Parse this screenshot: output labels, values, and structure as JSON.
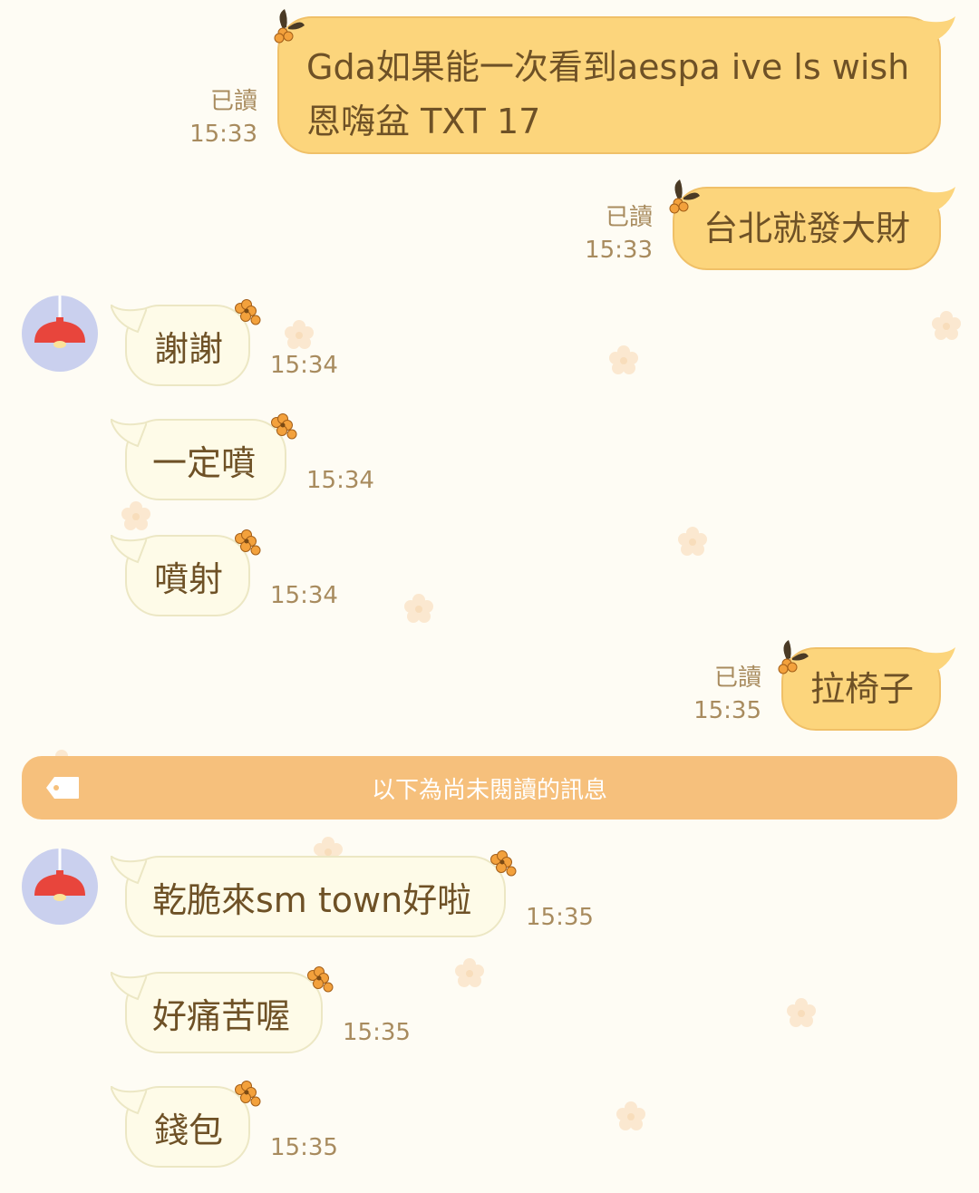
{
  "chat": {
    "outgoing": [
      {
        "line1": "Gda如果能一次看到aespa ive ls wish",
        "line2": "恩嗨盆 TXT 17",
        "read": "已讀",
        "time": "15:33"
      },
      {
        "text": "台北就發大財",
        "read": "已讀",
        "time": "15:33"
      },
      {
        "text": "拉椅子",
        "read": "已讀",
        "time": "15:35"
      }
    ],
    "incoming": [
      {
        "text": "謝謝",
        "time": "15:34"
      },
      {
        "text": "一定噴",
        "time": "15:34"
      },
      {
        "text": "噴射",
        "time": "15:34"
      },
      {
        "text": "乾脆來sm town好啦",
        "time": "15:35"
      },
      {
        "text": "好痛苦喔",
        "time": "15:35"
      },
      {
        "text": "錢包",
        "time": "15:35"
      }
    ],
    "unread_divider": "以下為尚未閱讀的訊息"
  },
  "colors": {
    "outgoing_bubble": "#fcd57c",
    "incoming_bubble": "#fefbe8",
    "unread_bar": "#f6c07c",
    "avatar_bg": "#cad0ee",
    "lamp": "#e8453c"
  },
  "icons": {
    "avatar": "pendant-lamp-icon",
    "bubble_decoration": "flower-icon",
    "unread_marker": "tag-icon"
  }
}
